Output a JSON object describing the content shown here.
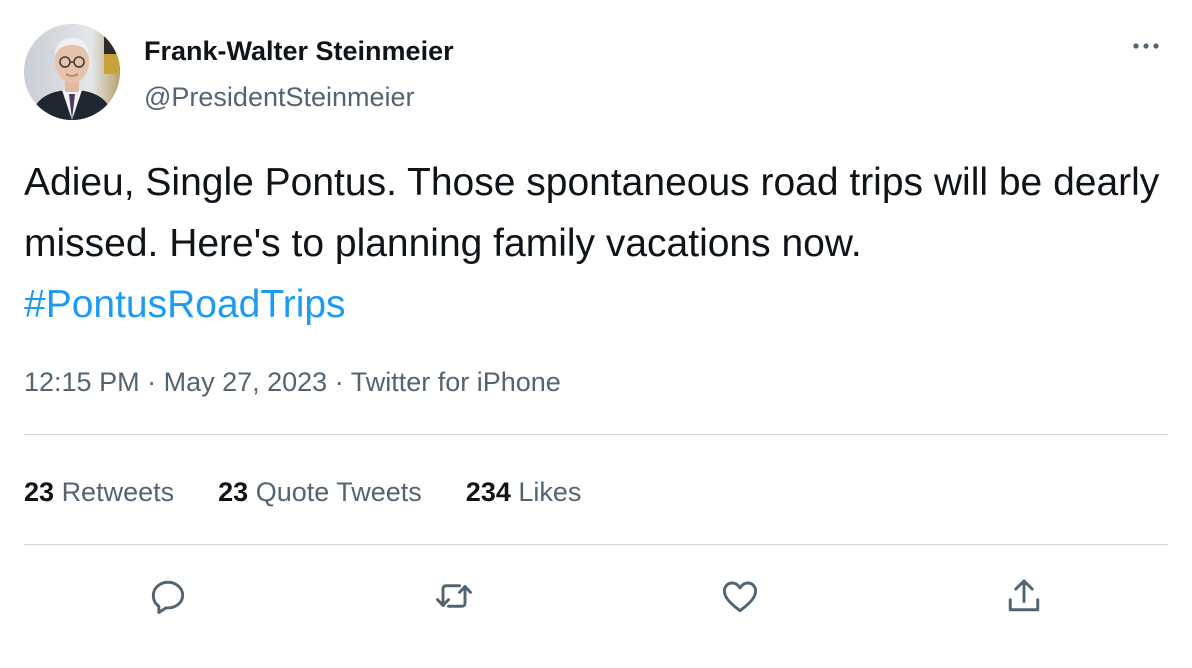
{
  "author": {
    "name": "Frank-Walter Steinmeier",
    "handle": "@PresidentSteinmeier"
  },
  "tweet": {
    "text": "Adieu, Single Pontus. Those spontaneous road trips will be dearly missed. Here's to planning family vacations now. ",
    "hashtag": "#PontusRoadTrips"
  },
  "meta": {
    "time": "12:15 PM",
    "separator1": " · ",
    "date": "May 27, 2023",
    "separator2": " · ",
    "source": "Twitter for iPhone"
  },
  "stats": {
    "retweets_count": "23",
    "retweets_label": "Retweets",
    "quotes_count": "23",
    "quotes_label": "Quote Tweets",
    "likes_count": "234",
    "likes_label": "Likes"
  },
  "icons": {
    "more": "more-icon",
    "reply": "reply-icon",
    "retweet": "retweet-icon",
    "like": "heart-icon",
    "share": "share-icon"
  },
  "colors": {
    "accent": "#1d9bf0",
    "secondary_text": "#536471",
    "primary_text": "#0f1419",
    "divider": "#cfd9de"
  }
}
